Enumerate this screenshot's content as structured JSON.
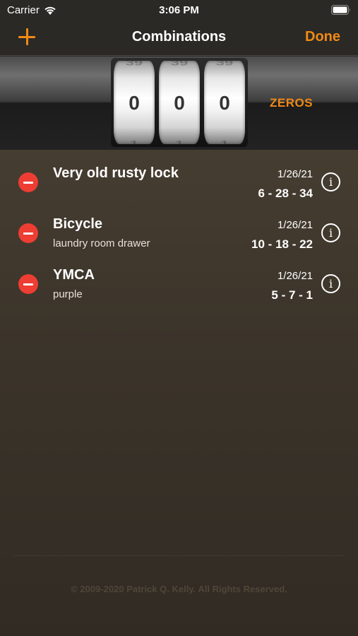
{
  "status_bar": {
    "carrier": "Carrier",
    "time": "3:06 PM",
    "wifi_icon": "wifi-icon",
    "battery_icon": "battery-icon"
  },
  "nav": {
    "title": "Combinations",
    "add_icon": "plus-icon",
    "done_label": "Done"
  },
  "dial": {
    "digits": [
      "0",
      "0",
      "0"
    ],
    "ghost_above": [
      "39",
      "39",
      "39"
    ],
    "ghost_below": [
      "1",
      "1",
      "1"
    ],
    "zeros_label": "ZEROS"
  },
  "combinations": [
    {
      "name": "Very old rusty lock",
      "note": "",
      "date": "1/26/21",
      "combination": "6 - 28 - 34"
    },
    {
      "name": "Bicycle",
      "note": "laundry room drawer",
      "date": "1/26/21",
      "combination": "10 - 18 - 22"
    },
    {
      "name": "YMCA",
      "note": "purple",
      "date": "1/26/21",
      "combination": "5 - 7 - 1"
    }
  ],
  "footer": {
    "copyright": "© 2009-2020 Patrick Q. Kelly. All Rights Reserved."
  },
  "colors": {
    "accent": "#f08a16",
    "delete": "#ee3d33",
    "background": "#3b342a"
  }
}
